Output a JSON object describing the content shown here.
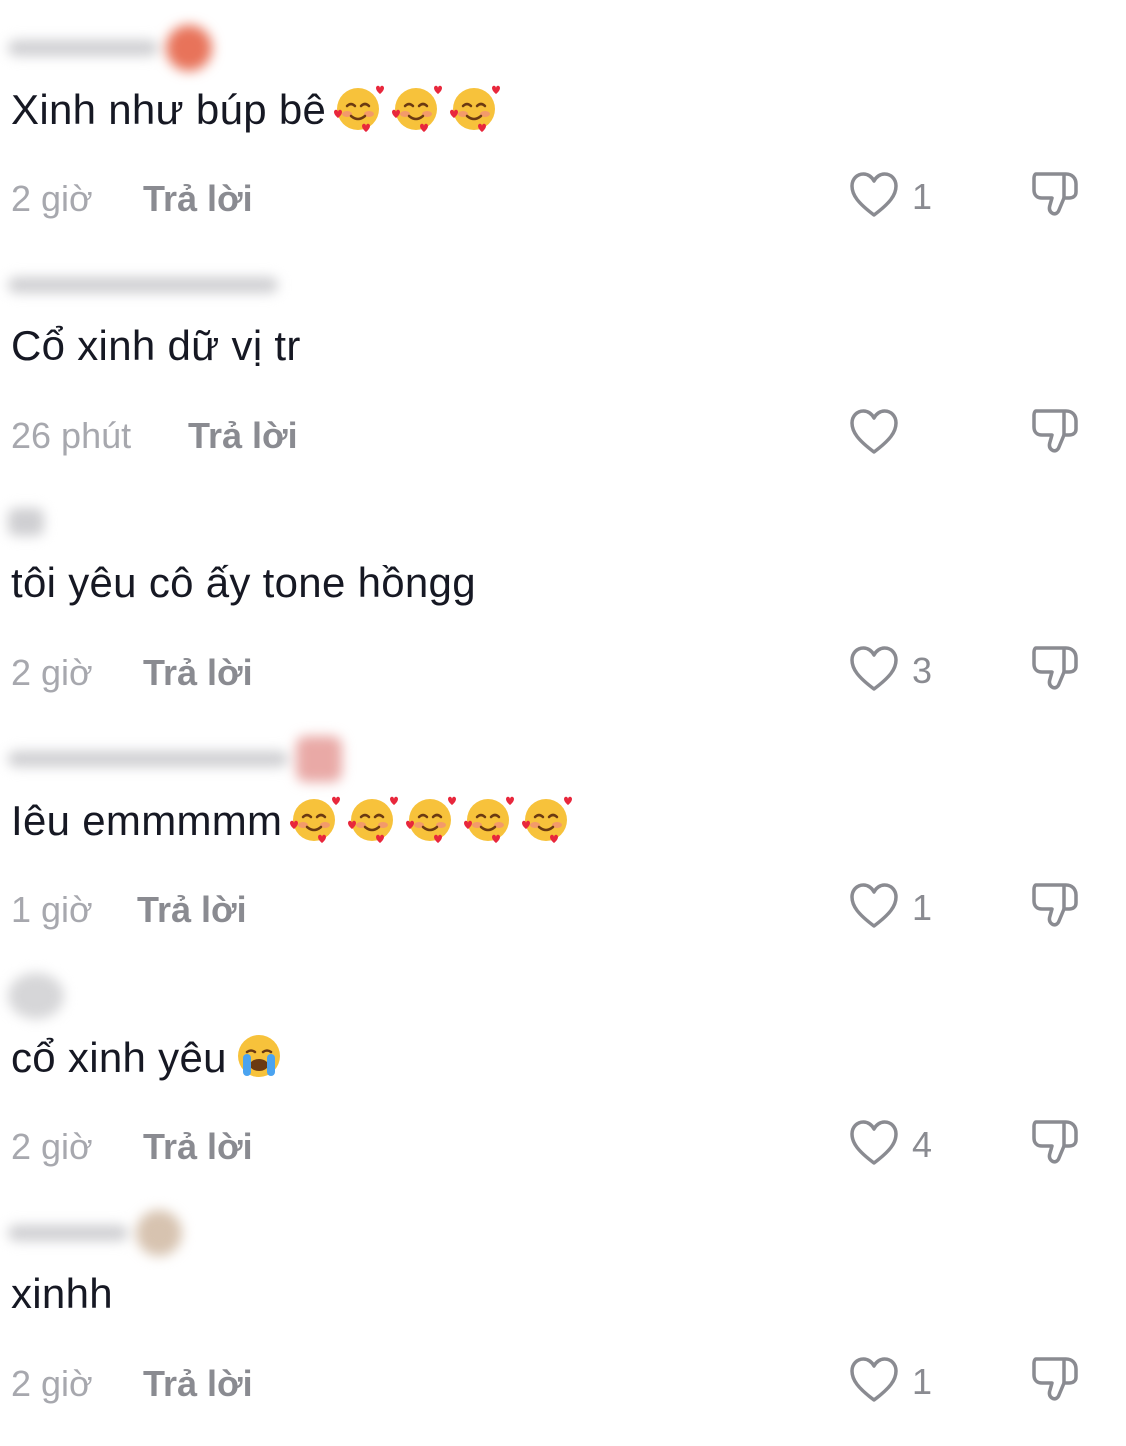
{
  "comments": [
    {
      "text": "Xinh như búp bê",
      "emoji": [
        "smiling-face-with-hearts",
        "smiling-face-with-hearts",
        "smiling-face-with-hearts"
      ],
      "time": "2 giờ",
      "reply": "Trả lời",
      "likes": "1"
    },
    {
      "text": "Cổ xinh dữ vị tr",
      "emoji": [],
      "time": "26 phút",
      "reply": "Trả lời",
      "likes": ""
    },
    {
      "text": "tôi yêu cô ấy tone hồngg",
      "emoji": [],
      "time": "2 giờ",
      "reply": "Trả lời",
      "likes": "3"
    },
    {
      "text": "Iêu emmmmm",
      "emoji": [
        "smiling-face-with-hearts",
        "smiling-face-with-hearts",
        "smiling-face-with-hearts",
        "smiling-face-with-hearts",
        "smiling-face-with-hearts"
      ],
      "time": "1 giờ",
      "reply": "Trả lời",
      "likes": "1"
    },
    {
      "text": "cổ xinh yêu",
      "emoji": [
        "loudly-crying-face"
      ],
      "time": "2 giờ",
      "reply": "Trả lời",
      "likes": "4"
    },
    {
      "text": "xinhh",
      "emoji": [],
      "time": "2 giờ",
      "reply": "Trả lời",
      "likes": "1"
    }
  ]
}
